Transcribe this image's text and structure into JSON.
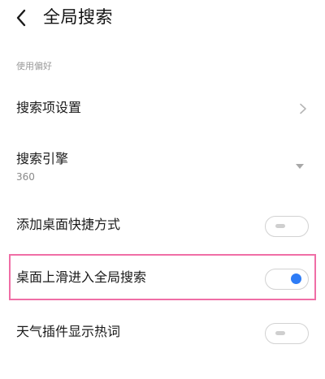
{
  "header": {
    "title": "全局搜索"
  },
  "section": {
    "label": "使用偏好"
  },
  "rows": [
    {
      "title": "搜索项设置"
    },
    {
      "title": "搜索引擎",
      "value": "360"
    },
    {
      "title": "添加桌面快捷方式",
      "toggle": "off"
    },
    {
      "title": "桌面上滑进入全局搜索",
      "toggle": "on"
    },
    {
      "title": "天气插件显示热词",
      "toggle": "off"
    }
  ],
  "colors": {
    "accent": "#2e7cf6",
    "highlight": "#f06ea6",
    "toggle_border": "#d2d2d2"
  },
  "icons": {
    "back": "chevron-left-icon",
    "more": "chevron-right-icon",
    "dropdown": "caret-down-icon"
  }
}
